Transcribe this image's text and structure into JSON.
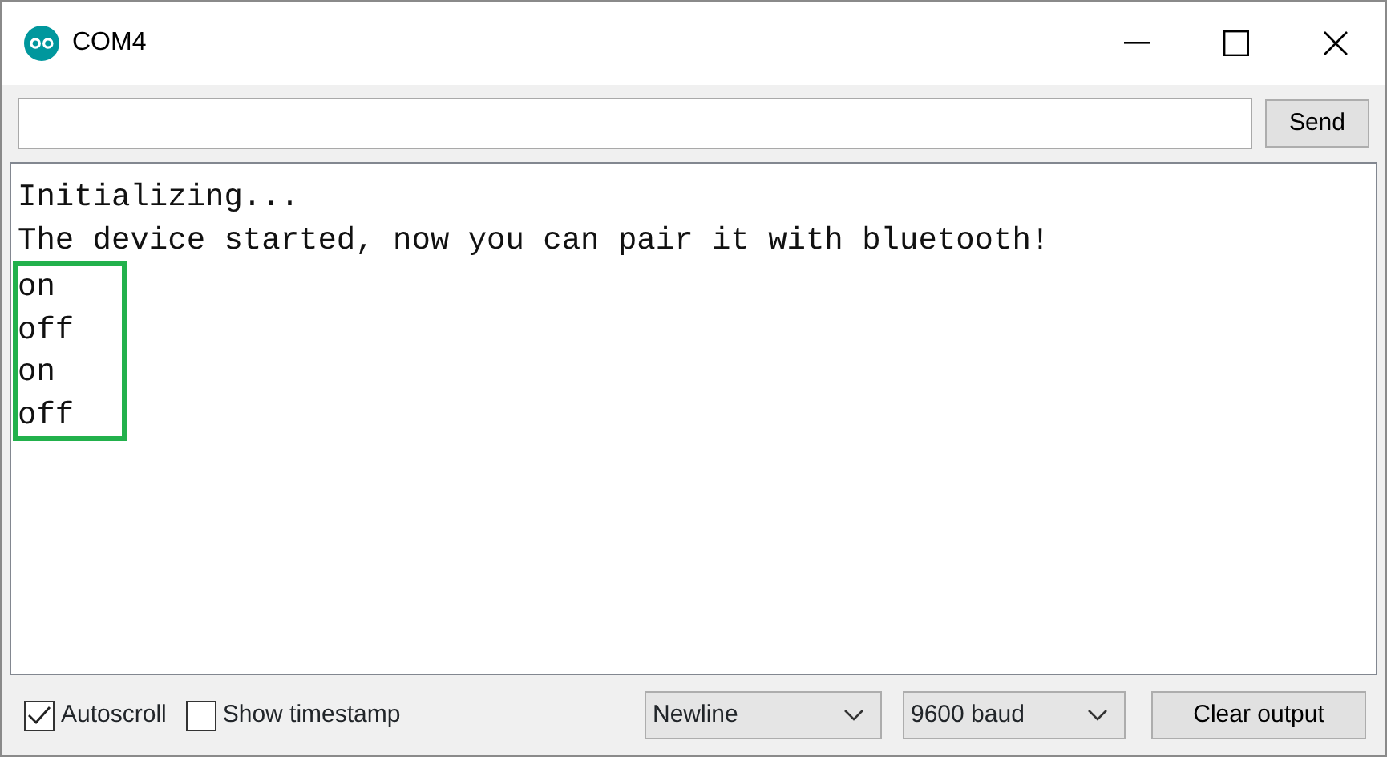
{
  "window": {
    "title": "COM4"
  },
  "send_button": "Send",
  "output": {
    "lines": [
      {
        "text": "Initializing...",
        "highlighted": false
      },
      {
        "text": "The device started, now you can pair it with bluetooth!",
        "highlighted": false
      },
      {
        "text": "on",
        "highlighted": true
      },
      {
        "text": "off",
        "highlighted": true
      },
      {
        "text": "on",
        "highlighted": true
      },
      {
        "text": "off",
        "highlighted": true
      }
    ]
  },
  "options": [
    {
      "label": "Autoscroll",
      "checked": true
    },
    {
      "label": "Show timestamp",
      "checked": false
    }
  ],
  "line_ending": "Newline",
  "baud_rate": "9600 baud",
  "clear_button": "Clear output"
}
